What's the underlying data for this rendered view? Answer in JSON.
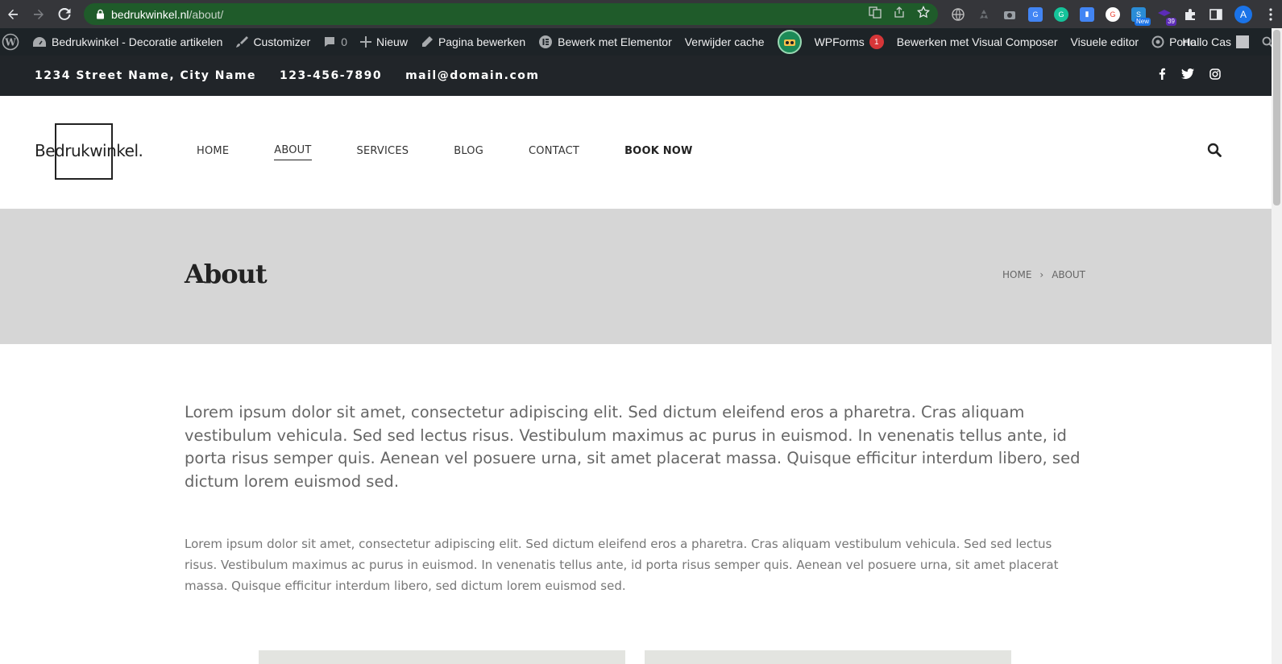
{
  "browser": {
    "url_host": "bedrukwinkel.nl",
    "url_path": "/about/",
    "profile_initial": "A",
    "ext_new_badge": "New",
    "ext_count_badge": "39"
  },
  "adminbar": {
    "site_name": "Bedrukwinkel - Decoratie artikelen",
    "customizer": "Customizer",
    "comments_count": "0",
    "new": "Nieuw",
    "edit_page": "Pagina bewerken",
    "elementor": "Bewerk met Elementor",
    "clear_cache": "Verwijder cache",
    "wpforms": "WPForms",
    "wpforms_count": "1",
    "visual_composer": "Bewerken met Visual Composer",
    "visual_editor": "Visuele editor",
    "porto": "Porto",
    "greeting": "Hallo Cas"
  },
  "topbar": {
    "address": "1234 Street Name, City Name",
    "phone": "123-456-7890",
    "email": "mail@domain.com"
  },
  "header": {
    "logo_text": "Bedrukwinkel.",
    "nav": [
      {
        "label": "HOME"
      },
      {
        "label": "ABOUT"
      },
      {
        "label": "SERVICES"
      },
      {
        "label": "BLOG"
      },
      {
        "label": "CONTACT"
      },
      {
        "label": "BOOK NOW"
      }
    ]
  },
  "titleband": {
    "title": "About",
    "crumb_home": "HOME",
    "crumb_sep": "›",
    "crumb_current": "ABOUT"
  },
  "content": {
    "lead": "Lorem ipsum dolor sit amet, consectetur adipiscing elit. Sed dictum eleifend eros a pharetra. Cras aliquam vestibulum vehicula. Sed sed lectus risus. Vestibulum maximus ac purus in euismod. In venenatis tellus ante, id porta risus semper quis. Aenean vel posuere urna, sit amet placerat massa. Quisque efficitur interdum libero, sed dictum lorem euismod sed.",
    "body": "Lorem ipsum dolor sit amet, consectetur adipiscing elit. Sed dictum eleifend eros a pharetra. Cras aliquam vestibulum vehicula. Sed sed lectus risus. Vestibulum maximus ac purus in euismod. In venenatis tellus ante, id porta risus semper quis. Aenean vel posuere urna, sit amet placerat massa. Quisque efficitur interdum libero, sed dictum lorem euismod sed."
  },
  "colors": {
    "omnibox": "#1f5b2a",
    "adminbar": "#1d2327",
    "topbar": "#212529",
    "titleband": "#d6d6d6"
  }
}
